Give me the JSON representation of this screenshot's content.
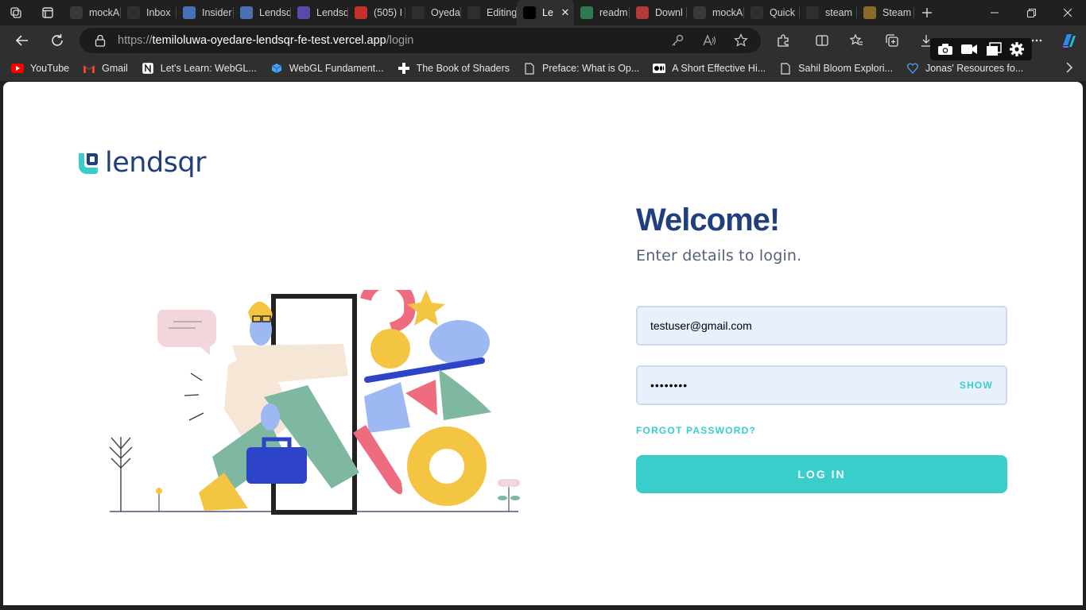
{
  "browser": {
    "tabs": [
      {
        "label": "mockA",
        "favicon": "mockapi-icon",
        "color": "#3a3a3a"
      },
      {
        "label": "Inbox",
        "favicon": "gmail-icon",
        "color": "#2f2f2f"
      },
      {
        "label": "Insider",
        "favicon": "docs-icon",
        "color": "#4a6fb5"
      },
      {
        "label": "Lendsq",
        "favicon": "docs-icon",
        "color": "#4a6fb5"
      },
      {
        "label": "Lendsq",
        "favicon": "list-icon",
        "color": "#5a4aa5"
      },
      {
        "label": "(505) I",
        "favicon": "youtube-icon",
        "color": "#c4302b"
      },
      {
        "label": "Oyeda",
        "favicon": "github-icon",
        "color": "#2f2f2f"
      },
      {
        "label": "Editing",
        "favicon": "github-icon",
        "color": "#2f2f2f"
      },
      {
        "label": "Le",
        "favicon": "vercel-icon",
        "color": "#000000",
        "active": true
      },
      {
        "label": "readm",
        "favicon": "sheets-icon",
        "color": "#2f7a52"
      },
      {
        "label": "Downl",
        "favicon": "download-site-icon",
        "color": "#b33a3a"
      },
      {
        "label": "mockA",
        "favicon": "mockapi-icon",
        "color": "#3a3a3a"
      },
      {
        "label": "Quick",
        "favicon": "github-icon",
        "color": "#2f2f2f"
      },
      {
        "label": "steam",
        "favicon": "search-icon",
        "color": "#2f2f2f"
      },
      {
        "label": "Steam",
        "favicon": "steam-icon",
        "color": "#8a6a2a"
      }
    ],
    "url": {
      "scheme": "https://",
      "host": "temiloluwa-oyedare-lendsqr-fe-test.vercel.app",
      "path": "/login"
    },
    "favorites": [
      {
        "label": "YouTube",
        "icon": "youtube-icon"
      },
      {
        "label": "Gmail",
        "icon": "gmail-icon"
      },
      {
        "label": "Let's Learn: WebGL...",
        "icon": "notion-icon"
      },
      {
        "label": "WebGL Fundament...",
        "icon": "cube-icon"
      },
      {
        "label": "The Book of Shaders",
        "icon": "plus-cross-icon"
      },
      {
        "label": "Preface: What is Op...",
        "icon": "page-icon"
      },
      {
        "label": "A Short Effective Hi...",
        "icon": "medium-icon"
      },
      {
        "label": "Sahil Bloom Explori...",
        "icon": "page-icon"
      },
      {
        "label": "Jonas' Resources fo...",
        "icon": "heart-icon"
      }
    ]
  },
  "page": {
    "brand": "lendsqr",
    "welcome": "Welcome!",
    "subtitle": "Enter details to login.",
    "email_value": "testuser@gmail.com",
    "password_value": "••••••••",
    "show_label": "SHOW",
    "forgot_label": "FORGOT PASSWORD?",
    "login_label": "LOG IN"
  },
  "colors": {
    "brand_navy": "#213f7d",
    "accent_teal": "#39cdcc",
    "input_bg": "#e8f0fe"
  }
}
